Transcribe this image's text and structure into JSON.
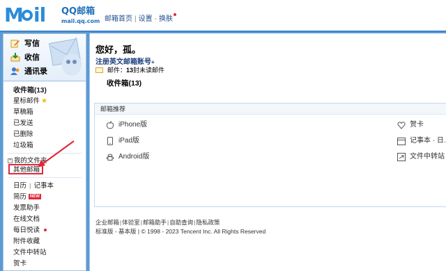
{
  "logo": {
    "mail": "M●il",
    "brand": "QQ邮箱",
    "url": "mail.qq.com"
  },
  "toplinks": {
    "home": "邮箱首页",
    "settings": "设置",
    "skin": "换肤"
  },
  "quick": {
    "write": "写信",
    "receive": "收信",
    "contacts": "通讯录"
  },
  "folders": {
    "inbox": "收件箱(13)",
    "starred": "星标邮件",
    "drafts": "草稿箱",
    "sent": "已发送",
    "deleted": "已删除",
    "spam": "垃圾箱",
    "my_folders": "我的文件夹",
    "other_mailboxes": "其他邮箱",
    "calendar": "日历",
    "notes": "记事本",
    "resume": "简历",
    "resume_badge": "NEW",
    "invoice": "发票助手",
    "docs": "在线文档",
    "daily": "每日悦读",
    "attachments": "附件收藏",
    "transfer": "文件中转站",
    "cards": "贺卡"
  },
  "main": {
    "greeting": "您好，孤。",
    "register": "注册英文邮箱账号",
    "mail_prefix": "邮件：",
    "mail_count": "13",
    "mail_suffix": " 封未读邮件",
    "inbox_link": "收件箱(13)"
  },
  "recommend": {
    "title": "邮箱推荐",
    "iphone": "iPhone版",
    "ipad": "iPad版",
    "android": "Android版",
    "cards": "贺卡",
    "notes": "记事本 · 日...",
    "transfer": "文件中转站"
  },
  "footer": {
    "links": [
      "企业邮箱",
      "体验室",
      "邮箱助手",
      "自助查询",
      "隐私政策"
    ],
    "line2": "标准版 - 基本版 | © 1998 - 2023 Tencent Inc. All Rights Reserved"
  },
  "colors": {
    "accent": "#2b8cd8",
    "frame": "#5b9bd5",
    "badge": "#e0283a"
  }
}
